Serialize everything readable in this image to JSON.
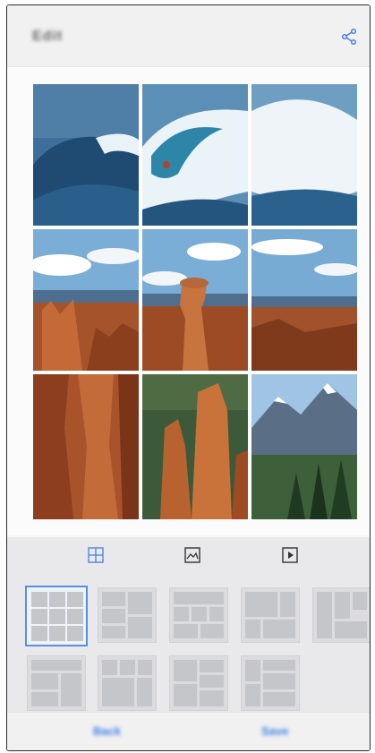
{
  "app": {
    "title": "Edit"
  },
  "header": {
    "share_icon": "share-icon"
  },
  "collage": {
    "photos": [
      "ocean-wave-surfer",
      "ocean-wave-surfer",
      "ocean-wave-surfer",
      "canyon-hoodoos",
      "canyon-hoodoos",
      "canyon-hoodoos",
      "canyon-rock-wall",
      "canyon-hoodoo-spires",
      "snowy-mountain-forest"
    ]
  },
  "tabs": [
    {
      "icon": "grid-layout-icon",
      "active": true
    },
    {
      "icon": "image-icon",
      "active": false
    },
    {
      "icon": "play-video-icon",
      "active": false
    }
  ],
  "layouts": {
    "selected_index": 0,
    "count": 9
  },
  "bottom": {
    "left_button": "Back",
    "right_button": "Save"
  },
  "colors": {
    "accent": "#5b8de0",
    "bar_bg": "#e9e9eb"
  }
}
